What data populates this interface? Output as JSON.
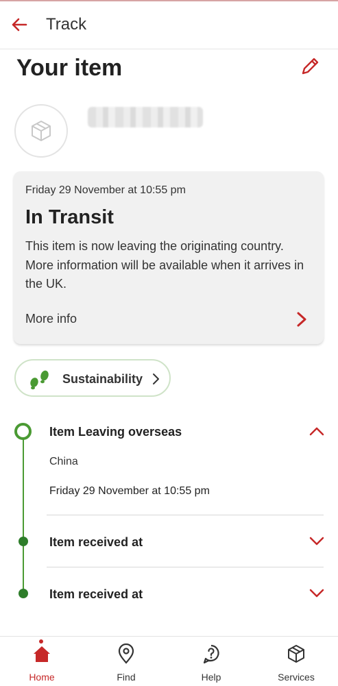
{
  "app_bar": {
    "title": "Track"
  },
  "page": {
    "title": "Your item"
  },
  "status_card": {
    "date": "Friday 29 November at 10:55 pm",
    "status": "In Transit",
    "description": "This item is now leaving the originating country. More information will be available when it arrives in the UK.",
    "more_label": "More info"
  },
  "sustainability": {
    "label": "Sustainability"
  },
  "timeline": [
    {
      "title": "Item Leaving overseas",
      "location": "China",
      "date": "Friday 29 November at 10:55 pm",
      "expanded": true
    },
    {
      "title": "Item received at",
      "expanded": false
    },
    {
      "title": "Item received at",
      "expanded": false
    }
  ],
  "nav": [
    {
      "label": "Home",
      "icon": "home-icon",
      "active": true
    },
    {
      "label": "Find",
      "icon": "location-pin-icon"
    },
    {
      "label": "Help",
      "icon": "help-icon"
    },
    {
      "label": "Services",
      "icon": "parcel-icon"
    }
  ],
  "colors": {
    "accent": "#c62828",
    "green": "#4a9a33",
    "card_bg": "#f1f1f1"
  }
}
